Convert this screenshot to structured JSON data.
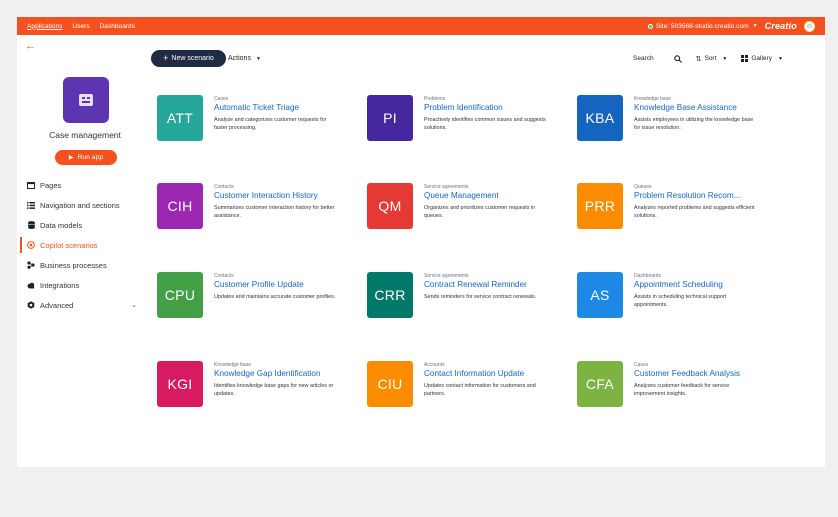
{
  "topbar": {
    "nav": [
      "Applications",
      "Users",
      "Dashboards"
    ],
    "site": "Site: 503568-studio.creatio.com",
    "brand": "Creatio"
  },
  "sidebar": {
    "app_name": "Case management",
    "run_label": "Run app",
    "items": [
      {
        "label": "Pages",
        "icon": "window-icon"
      },
      {
        "label": "Navigation and sections",
        "icon": "list-icon"
      },
      {
        "label": "Data models",
        "icon": "database-icon"
      },
      {
        "label": "Copilot scenarios",
        "icon": "copilot-icon"
      },
      {
        "label": "Business processes",
        "icon": "process-icon"
      },
      {
        "label": "Integrations",
        "icon": "cloud-icon"
      },
      {
        "label": "Advanced",
        "icon": "gear-icon"
      }
    ]
  },
  "toolbar": {
    "new_label": "New scenario",
    "actions_label": "Actions",
    "search_label": "Search",
    "sort_label": "Sort",
    "view_label": "Gallery"
  },
  "cards": [
    {
      "abbr": "ATT",
      "color": "#26a69a",
      "category": "Cases",
      "title": "Automatic Ticket Triage",
      "desc": "Analyze and categorizes customer requests for faster processing."
    },
    {
      "abbr": "PI",
      "color": "#4527a0",
      "category": "Problems",
      "title": "Problem Identification",
      "desc": "Proactively identifies common issues and suggests solutions."
    },
    {
      "abbr": "KBA",
      "color": "#1565c0",
      "category": "Knowledge base",
      "title": "Knowledge Base Assistance",
      "desc": "Assists employees in utilizing the knowledge base for issue resolution."
    },
    {
      "abbr": "CIH",
      "color": "#9c27b0",
      "category": "Contacts",
      "title": "Customer Interaction History",
      "desc": "Summarizes customer interaction history for better assistance."
    },
    {
      "abbr": "QM",
      "color": "#e53935",
      "category": "Service agreements",
      "title": "Queue Management",
      "desc": "Organizes and prioritizes customer requests in queues."
    },
    {
      "abbr": "PRR",
      "color": "#fb8c00",
      "category": "Queues",
      "title": "Problem Resolution Recom...",
      "desc": "Analyzes reported problems and suggests efficient solutions."
    },
    {
      "abbr": "CPU",
      "color": "#43a047",
      "category": "Contacts",
      "title": "Customer Profile Update",
      "desc": "Updates and maintains accurate customer profiles."
    },
    {
      "abbr": "CRR",
      "color": "#00796b",
      "category": "Service agreements",
      "title": "Contract Renewal Reminder",
      "desc": "Sends reminders for service contract renewals."
    },
    {
      "abbr": "AS",
      "color": "#1e88e5",
      "category": "Dashboards",
      "title": "Appointment Scheduling",
      "desc": "Assists in scheduling technical support appointments."
    },
    {
      "abbr": "KGI",
      "color": "#d81b60",
      "category": "Knowledge base",
      "title": "Knowledge Gap Identification",
      "desc": "Identifies knowledge base gaps for new articles or updates."
    },
    {
      "abbr": "CIU",
      "color": "#fb8c00",
      "category": "Accounts",
      "title": "Contact Information Update",
      "desc": "Updates contact information for customers and partners."
    },
    {
      "abbr": "CFA",
      "color": "#7cb342",
      "category": "Cases",
      "title": "Customer Feedback Analysis",
      "desc": "Analyzes customer feedback for service improvement insights."
    }
  ]
}
